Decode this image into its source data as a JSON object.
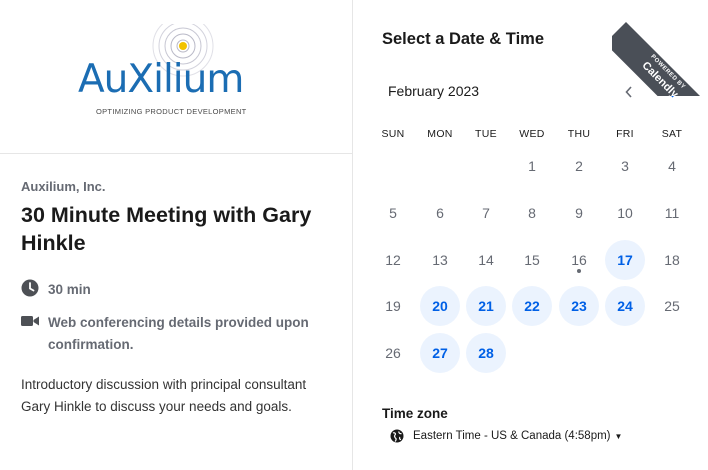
{
  "brand": {
    "logo_name": "AuXilium",
    "logo_tagline": "OPTIMIZING PRODUCT DEVELOPMENT",
    "logo_color": "#1b6db3",
    "accent_dot_color": "#f2c300"
  },
  "event": {
    "organizer": "Auxilium, Inc.",
    "title": "30 Minute Meeting with Gary Hinkle",
    "duration": "30 min",
    "duration_icon": "clock-icon",
    "location": "Web conferencing details provided upon confirmation.",
    "location_icon": "video-camera-icon",
    "description": "Introductory discussion with principal consultant Gary Hinkle to discuss your needs and goals."
  },
  "scheduler": {
    "heading": "Select a Date & Time",
    "month_label": "February 2023",
    "prev_icon": "chevron-left-icon",
    "next_icon": "chevron-right-icon",
    "weekdays": [
      "SUN",
      "MON",
      "TUE",
      "WED",
      "THU",
      "FRI",
      "SAT"
    ],
    "first_weekday_index": 3,
    "days_in_month": 28,
    "today": 16,
    "available_days": [
      17,
      20,
      21,
      22,
      23,
      24,
      27,
      28
    ],
    "accent_color": "#0060e6",
    "available_bg": "#ebf3fe"
  },
  "timezone": {
    "label": "Time zone",
    "value": "Eastern Time - US & Canada (4:58pm)",
    "icon": "globe-icon"
  },
  "ribbon": {
    "line1": "POWERED BY",
    "line2": "Calendly"
  }
}
